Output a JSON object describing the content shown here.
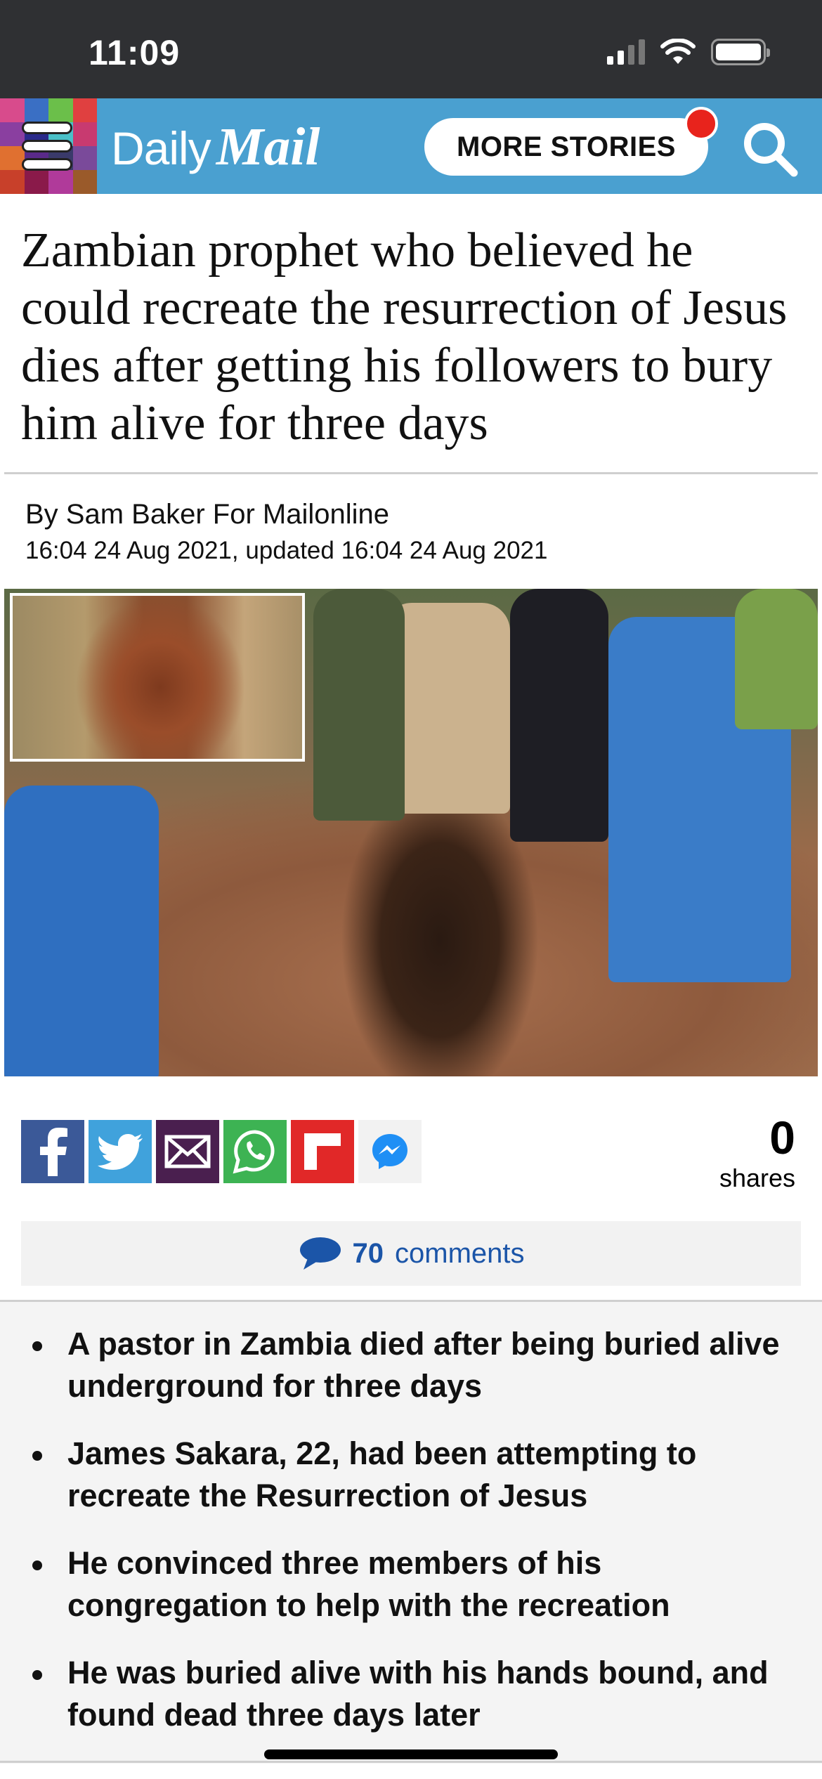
{
  "status_bar": {
    "time": "11:09"
  },
  "header": {
    "logo_daily": "Daily",
    "logo_mail": "Mail",
    "more_stories": "MORE STORIES",
    "colors": {
      "bar": "#4aa0d0",
      "notification": "#e8231c"
    }
  },
  "article": {
    "headline": "Zambian prophet who believed he could recreate the resurrection of Jesus dies after getting his followers to bury him alive for three days",
    "byline": "By Sam Baker For Mailonline",
    "dateline": "16:04 24 Aug 2021, updated 16:04 24 Aug 2021"
  },
  "share": {
    "buttons": [
      "facebook-icon",
      "twitter-icon",
      "email-icon",
      "whatsapp-icon",
      "flipboard-icon",
      "messenger-icon"
    ],
    "count": "0",
    "label": "shares"
  },
  "comments": {
    "count": "70",
    "label": "comments"
  },
  "bullets": [
    "A pastor in Zambia died after being buried alive underground for three days",
    "James Sakara, 22, had been attempting to recreate the Resurrection of Jesus",
    "He convinced three members of his congregation to help with the recreation",
    "He was buried alive with his hands bound, and found dead three days later"
  ]
}
